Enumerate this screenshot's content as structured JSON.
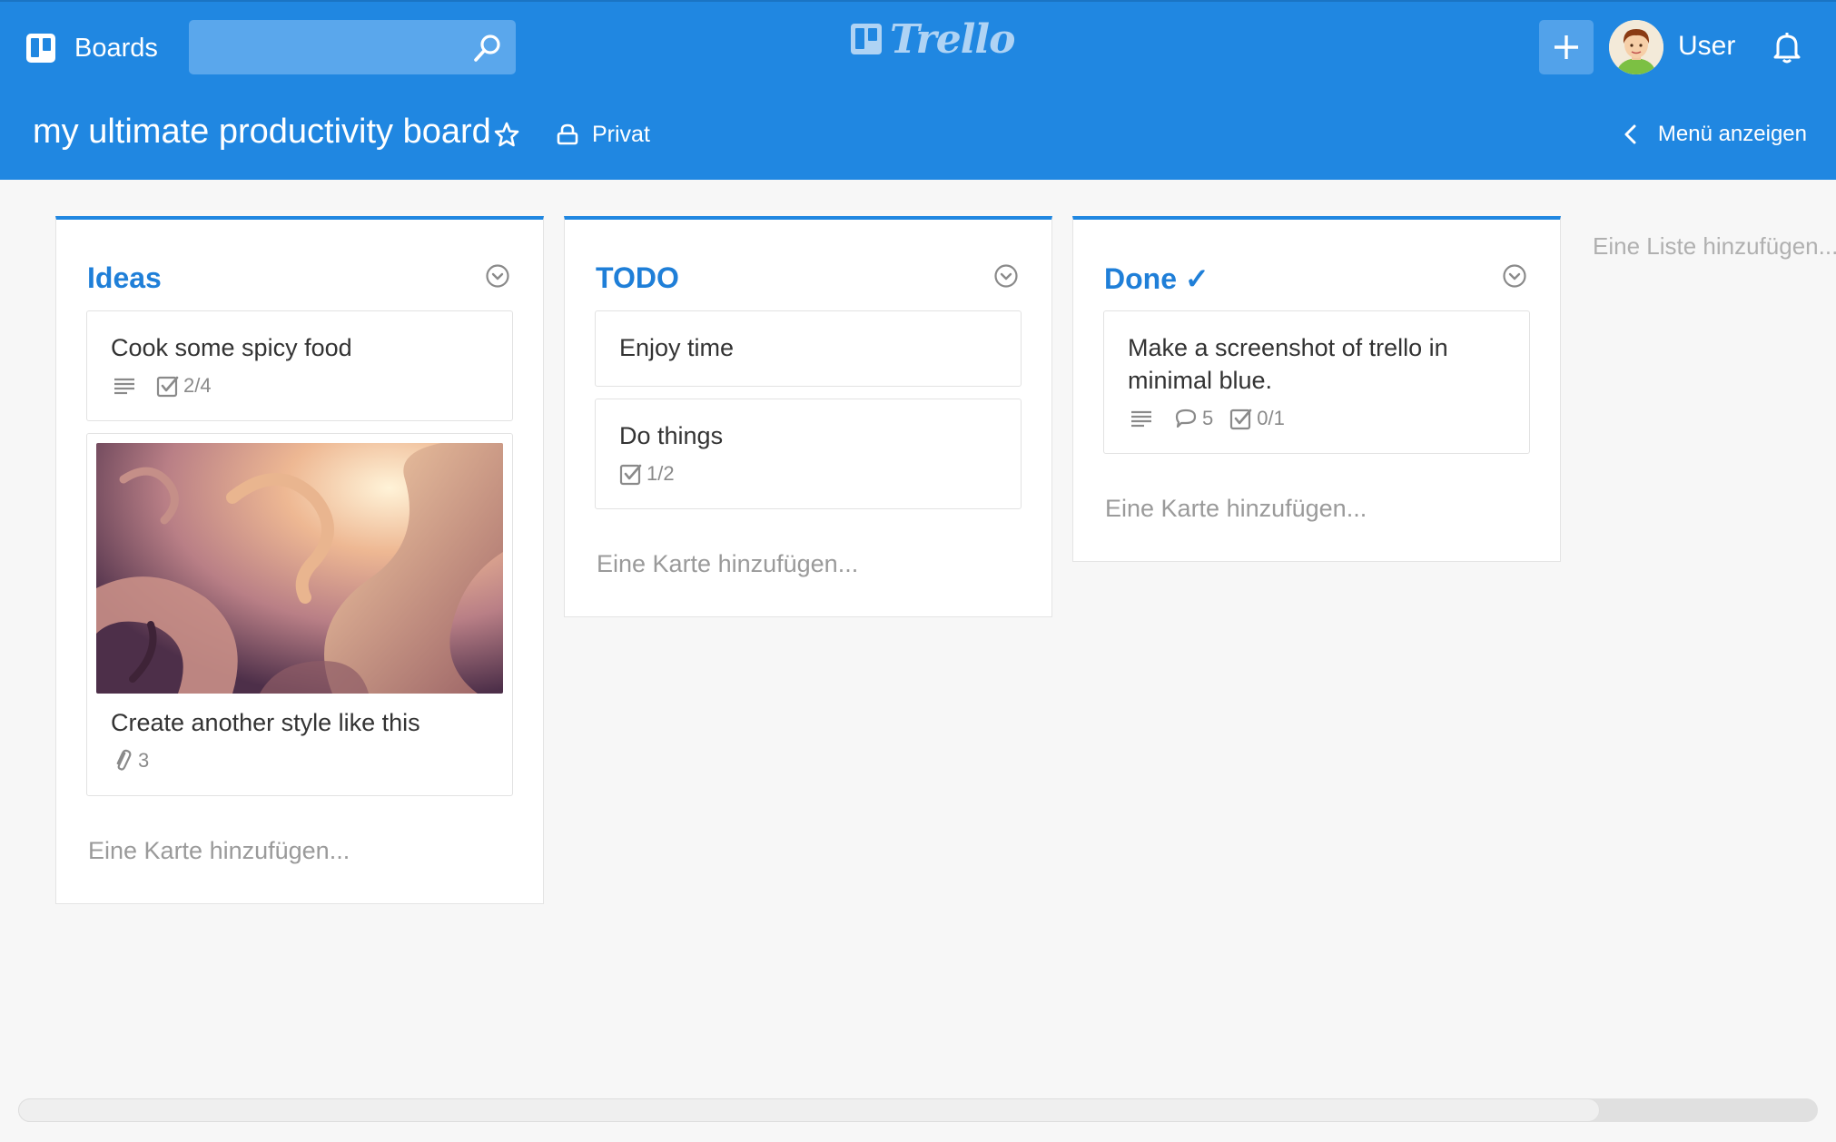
{
  "header": {
    "boards_label": "Boards",
    "search_placeholder": "",
    "logo_text": "Trello",
    "user_name": "User"
  },
  "board": {
    "title": "my ultimate productivity board",
    "visibility": "Privat",
    "menu_label": "Menü anzeigen",
    "add_list_label": "Eine Liste hinzufügen..."
  },
  "lists": [
    {
      "title": "Ideas",
      "add_card_label": "Eine Karte hinzufügen...",
      "cards": [
        {
          "title": "Cook some spicy food",
          "description": true,
          "checklist": "2/4"
        },
        {
          "title": "Create another style like this",
          "cover": true,
          "attachments": "3"
        }
      ]
    },
    {
      "title": "TODO",
      "add_card_label": "Eine Karte hinzufügen...",
      "cards": [
        {
          "title": "Enjoy time"
        },
        {
          "title": "Do things",
          "checklist": "1/2"
        }
      ]
    },
    {
      "title": "Done ✓",
      "add_card_label": "Eine Karte hinzufügen...",
      "cards": [
        {
          "title": "Make a screenshot of trello in minimal blue.",
          "description": true,
          "comments": "5",
          "checklist": "0/1"
        }
      ]
    }
  ],
  "colors": {
    "accent": "#2087e1",
    "list_title": "#1f7fd8",
    "background": "#f7f7f7"
  },
  "icons": [
    "boards-icon",
    "search-icon",
    "plus-icon",
    "bell-icon",
    "star-icon",
    "lock-icon",
    "chevron-left-icon",
    "chevron-down-circle-icon",
    "description-icon",
    "checklist-icon",
    "comment-icon",
    "attachment-icon"
  ]
}
